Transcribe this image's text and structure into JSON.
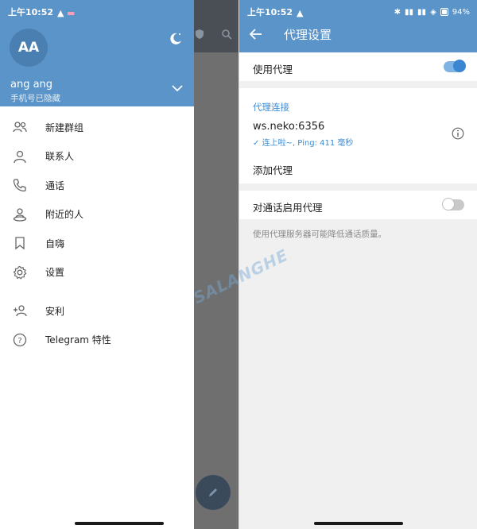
{
  "left": {
    "status": {
      "time": "上午10:52",
      "battery": "94"
    },
    "drawer": {
      "avatar_initials": "AA",
      "user_name": "ang ang",
      "user_phone": "手机号已隐藏",
      "menu": [
        {
          "icon": "new-group-icon",
          "label": "新建群组"
        },
        {
          "icon": "contacts-icon",
          "label": "联系人"
        },
        {
          "icon": "phone-icon",
          "label": "通话"
        },
        {
          "icon": "people-nearby-icon",
          "label": "附近的人"
        },
        {
          "icon": "bookmark-icon",
          "label": "自嗨"
        },
        {
          "icon": "gear-icon",
          "label": "设置"
        }
      ],
      "menu2": [
        {
          "icon": "invite-friends-icon",
          "label": "安利"
        },
        {
          "icon": "help-icon",
          "label": "Telegram 特性"
        }
      ]
    }
  },
  "right": {
    "status": {
      "time": "上午10:52",
      "battery": "94"
    },
    "title": "代理设置",
    "use_proxy_label": "使用代理",
    "use_proxy_enabled": true,
    "section_title": "代理连接",
    "proxy": {
      "host": "ws.neko:6356",
      "status": "连上啦~, Ping: 411 毫秒"
    },
    "add_proxy_label": "添加代理",
    "calls_proxy_label": "对通话启用代理",
    "calls_proxy_enabled": false,
    "note": "使用代理服务器可能降低通话质量。"
  },
  "watermark": "SALANGHE",
  "colors": {
    "header_blue": "#5b94c8",
    "accent_blue": "#3b8bd4"
  }
}
